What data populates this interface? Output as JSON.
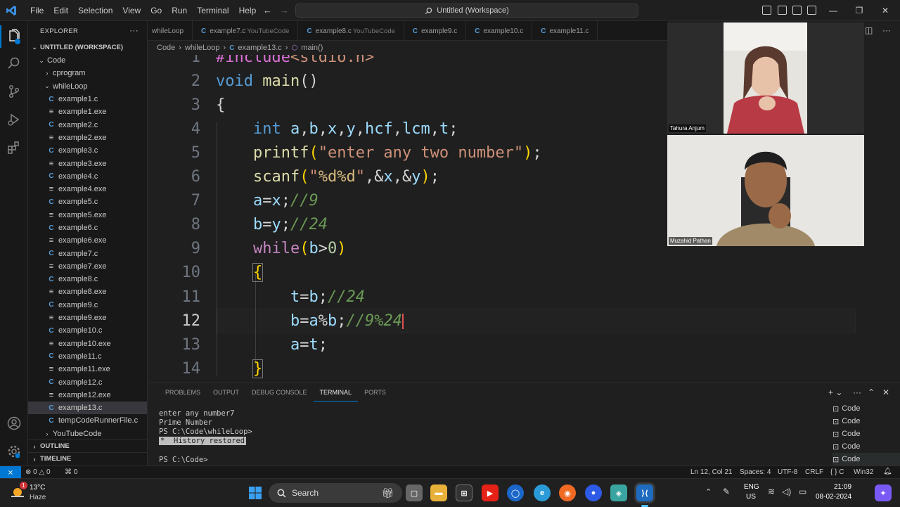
{
  "titlebar": {
    "menu": [
      "File",
      "Edit",
      "Selection",
      "View",
      "Go",
      "Run",
      "Terminal",
      "Help"
    ],
    "command_center": "Untitled (Workspace)"
  },
  "sidebar": {
    "explorer_title": "EXPLORER",
    "workspace_title": "UNTITLED (WORKSPACE)",
    "code_folder": "Code",
    "cprogram_folder": "cprogram",
    "whileloop_folder": "whileLoop",
    "files": [
      {
        "name": "example1.c",
        "type": "c"
      },
      {
        "name": "example1.exe",
        "type": "exe"
      },
      {
        "name": "example2.c",
        "type": "c"
      },
      {
        "name": "example2.exe",
        "type": "exe"
      },
      {
        "name": "example3.c",
        "type": "c"
      },
      {
        "name": "example3.exe",
        "type": "exe"
      },
      {
        "name": "example4.c",
        "type": "c"
      },
      {
        "name": "example4.exe",
        "type": "exe"
      },
      {
        "name": "example5.c",
        "type": "c"
      },
      {
        "name": "example5.exe",
        "type": "exe"
      },
      {
        "name": "example6.c",
        "type": "c"
      },
      {
        "name": "example6.exe",
        "type": "exe"
      },
      {
        "name": "example7.c",
        "type": "c"
      },
      {
        "name": "example7.exe",
        "type": "exe"
      },
      {
        "name": "example8.c",
        "type": "c"
      },
      {
        "name": "example8.exe",
        "type": "exe"
      },
      {
        "name": "example9.c",
        "type": "c"
      },
      {
        "name": "example9.exe",
        "type": "exe"
      },
      {
        "name": "example10.c",
        "type": "c"
      },
      {
        "name": "example10.exe",
        "type": "exe"
      },
      {
        "name": "example11.c",
        "type": "c"
      },
      {
        "name": "example11.exe",
        "type": "exe"
      },
      {
        "name": "example12.c",
        "type": "c"
      },
      {
        "name": "example12.exe",
        "type": "exe"
      },
      {
        "name": "example13.c",
        "type": "c",
        "selected": true
      },
      {
        "name": "tempCodeRunnerFile.c",
        "type": "c"
      }
    ],
    "youtube_folder": "YouTubeCode",
    "outline": "OUTLINE",
    "timeline": "TIMELINE"
  },
  "tabs": [
    {
      "label": "whileLoop",
      "sub": ""
    },
    {
      "label": "example7.c",
      "sub": "YouTubeCode"
    },
    {
      "label": "example8.c",
      "sub": "YouTubeCode"
    },
    {
      "label": "example9.c",
      "sub": ""
    },
    {
      "label": "example10.c",
      "sub": ""
    },
    {
      "label": "example11.c",
      "sub": ""
    }
  ],
  "breadcrumb": {
    "parts": [
      "Code",
      "whileLoop",
      "example13.c",
      "main()"
    ]
  },
  "editor": {
    "line_numbers": [
      "1",
      "2",
      "3",
      "4",
      "5",
      "6",
      "7",
      "8",
      "9",
      "10",
      "11",
      "12",
      "13",
      "14"
    ]
  },
  "panel": {
    "tabs": [
      "PROBLEMS",
      "OUTPUT",
      "DEBUG CONSOLE",
      "TERMINAL",
      "PORTS"
    ],
    "active_tab": "TERMINAL",
    "lines": [
      "enter any number7",
      "Prime Number",
      "PS C:\\Code\\whileLoop>"
    ],
    "history": "*  History restored",
    "prompt": "PS C:\\Code>",
    "terminals": [
      "Code",
      "Code",
      "Code",
      "Code",
      "Code"
    ]
  },
  "status": {
    "errors": "0",
    "warnings": "0",
    "ports": "0",
    "position": "Ln 12, Col 21",
    "spaces": "Spaces: 4",
    "encoding": "UTF-8",
    "eol": "CRLF",
    "language": "C",
    "platform": "Win32"
  },
  "participants": [
    "Tahura Anjum",
    "Muzahid Pathan"
  ],
  "taskbar": {
    "weather_temp": "13°C",
    "weather_desc": "Haze",
    "weather_badge": "1",
    "search": "Search",
    "lang1": "ENG",
    "lang2": "US",
    "time": "21:09",
    "date": "08-02-2024"
  },
  "colors": {
    "accent": "#0078d4",
    "editor_bg": "#1f1f1f",
    "sidebar_bg": "#181818"
  }
}
